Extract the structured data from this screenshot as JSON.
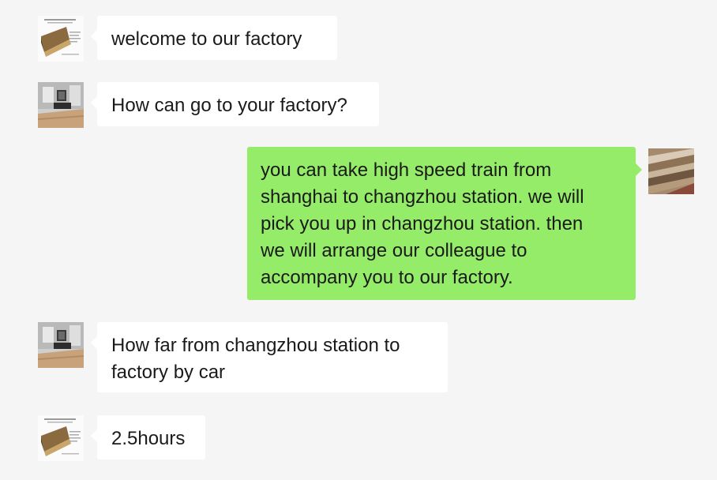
{
  "chat": {
    "messages": [
      {
        "direction": "incoming",
        "sender_avatar": "factory-avatar",
        "text": "welcome to our factory"
      },
      {
        "direction": "incoming",
        "sender_avatar": "customer-avatar",
        "text": "How can go to your factory?"
      },
      {
        "direction": "outgoing",
        "sender_avatar": "self-avatar",
        "text": "you can take high speed train from\nshanghai to changzhou station. we will\npick you up in changzhou station. then\nwe will arrange our colleague to\naccompany you to our factory."
      },
      {
        "direction": "incoming",
        "sender_avatar": "customer-avatar",
        "text": "How far from changzhou station to\nfactory by car"
      },
      {
        "direction": "incoming",
        "sender_avatar": "factory-avatar",
        "text": "2.5hours"
      }
    ]
  },
  "colors": {
    "background": "#f5f5f5",
    "incoming_bubble": "#ffffff",
    "outgoing_bubble": "#95ec69",
    "text": "#1a1a1a"
  }
}
